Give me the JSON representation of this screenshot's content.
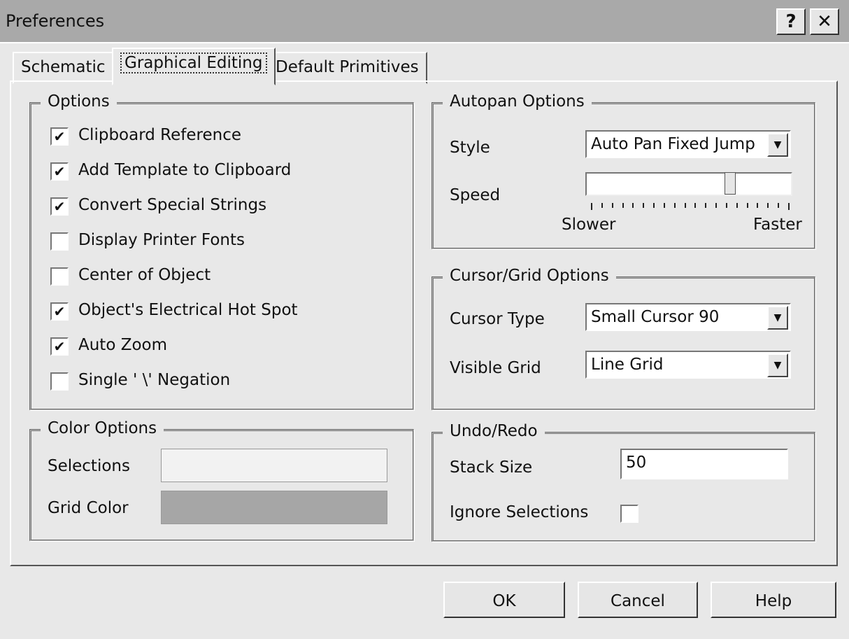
{
  "window": {
    "title": "Preferences",
    "help": "?",
    "close": "✕"
  },
  "tabs": [
    "Schematic",
    "Graphical Editing",
    "Default Primitives"
  ],
  "options": {
    "title": "Options",
    "items": [
      {
        "label": "Clipboard Reference",
        "checked": true
      },
      {
        "label": "Add Template to Clipboard",
        "checked": true
      },
      {
        "label": "Convert Special Strings",
        "checked": true
      },
      {
        "label": "Display Printer Fonts",
        "checked": false
      },
      {
        "label": "Center of Object",
        "checked": false
      },
      {
        "label": "Object's Electrical Hot Spot",
        "checked": true
      },
      {
        "label": "Auto Zoom",
        "checked": true
      },
      {
        "label": "Single ' \\' Negation",
        "checked": false
      }
    ]
  },
  "color_options": {
    "title": "Color Options",
    "selections_label": "Selections",
    "grid_label": "Grid Color",
    "selections_color": "#f2f2f2",
    "grid_color": "#a6a6a6"
  },
  "autopan": {
    "title": "Autopan Options",
    "style_label": "Style",
    "style_value": "Auto Pan Fixed Jump",
    "speed_label": "Speed",
    "speed_fraction": 0.7,
    "slower": "Slower",
    "faster": "Faster"
  },
  "cursor_grid": {
    "title": "Cursor/Grid Options",
    "cursor_label": "Cursor Type",
    "cursor_value": "Small Cursor 90",
    "grid_label": "Visible Grid",
    "grid_value": "Line Grid"
  },
  "undo": {
    "title": "Undo/Redo",
    "stack_label": "Stack Size",
    "stack_value": "50",
    "ignore_label": "Ignore Selections",
    "ignore_checked": false
  },
  "buttons": {
    "ok": "OK",
    "cancel": "Cancel",
    "help": "Help"
  }
}
